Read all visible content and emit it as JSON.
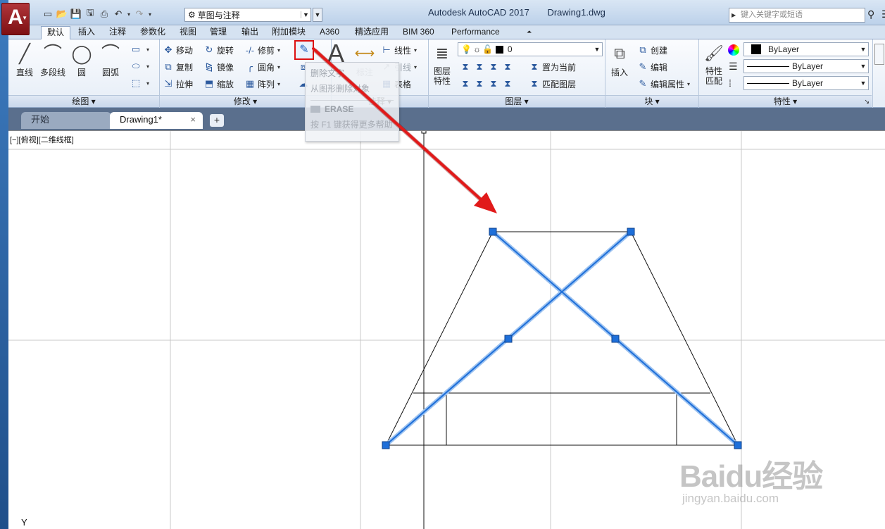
{
  "app": {
    "title": "Autodesk AutoCAD 2017",
    "document": "Drawing1.dwg",
    "logo_letter": "A",
    "workspace": "草图与注释",
    "search_placeholder": "键入关键字或短语"
  },
  "ribbon_tabs": [
    "默认",
    "插入",
    "注释",
    "参数化",
    "视图",
    "管理",
    "输出",
    "附加模块",
    "A360",
    "精选应用",
    "BIM 360",
    "Performance"
  ],
  "active_tab": "默认",
  "panels": {
    "draw": {
      "title": "绘图",
      "line": "直线",
      "polyline": "多段线",
      "circle": "圆",
      "arc": "圆弧"
    },
    "modify": {
      "title": "修改",
      "move": "移动",
      "rotate": "旋转",
      "trim": "修剪",
      "copy": "复制",
      "mirror": "镜像",
      "fillet": "圆角",
      "stretch": "拉伸",
      "scale": "缩放",
      "array": "阵列"
    },
    "annotation": {
      "title": "注释",
      "text_glyph": "A",
      "dimension": "标注",
      "linear": "线性",
      "leader": "引线",
      "table": "表格"
    },
    "layers": {
      "title": "图层",
      "layer_properties": "图层\n特性",
      "current_layer": "0",
      "make_current": "置为当前",
      "match_layer": "匹配图层"
    },
    "block": {
      "title": "块",
      "insert": "插入",
      "create": "创建",
      "edit": "编辑",
      "edit_attributes": "编辑属性"
    },
    "properties": {
      "title": "特性",
      "match": "特性\n匹配",
      "color": "ByLayer",
      "linetype": "ByLayer",
      "lineweight": "ByLayer"
    }
  },
  "tooltip": {
    "title": "删除文字",
    "description": "从图形删除对象",
    "command": "ERASE",
    "help": "按 F1 键获得更多帮助"
  },
  "file_tabs": {
    "start": "开始",
    "drawing": "Drawing1*",
    "close": "×",
    "add": "+"
  },
  "viewport": {
    "label": "[−][俯视][二维线框]",
    "ucs_y": "Y"
  },
  "watermark": {
    "logo": "Baidu经验",
    "url": "jingyan.baidu.com"
  },
  "colors": {
    "selection_blue": "#1e6fd9",
    "grip_blue": "#1e6fd9",
    "arrow_red": "#e11a1a",
    "highlight_red": "#d11111"
  }
}
